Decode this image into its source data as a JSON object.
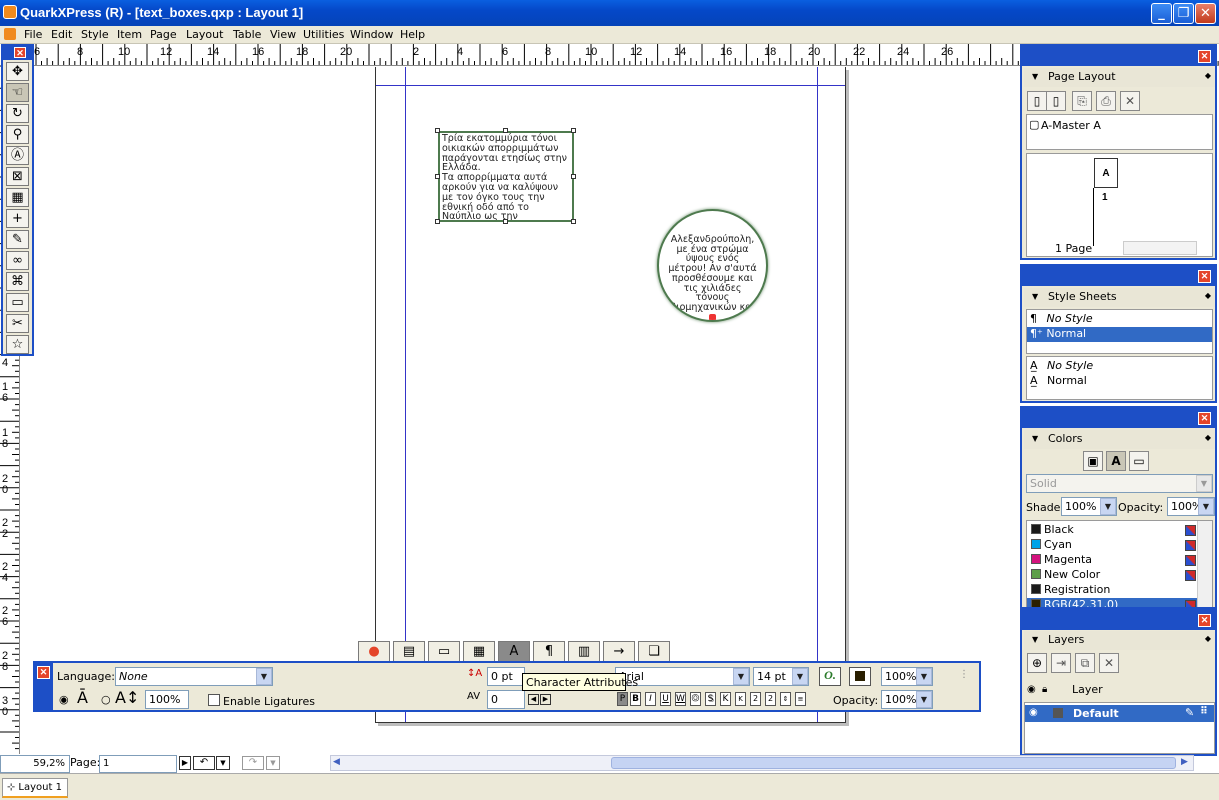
{
  "window": {
    "title": "QuarkXPress (R) - [text_boxes.qxp : Layout 1]",
    "min": "_",
    "restore": "❐",
    "close": "✕"
  },
  "menubar": {
    "items": [
      "File",
      "Edit",
      "Style",
      "Item",
      "Page",
      "Layout",
      "Table",
      "View",
      "Utilities",
      "Window",
      "Help"
    ],
    "mdi": [
      "_",
      "❐",
      "✕"
    ]
  },
  "rulers": {
    "horizontal": [
      "6",
      "8",
      "10",
      "12",
      "14",
      "16",
      "18",
      "20",
      "2",
      "4",
      "6",
      "8",
      "10",
      "12",
      "14",
      "16",
      "18",
      "20",
      "22",
      "24",
      "26"
    ],
    "vertical": [
      "4",
      "1 6",
      "1 8",
      "2 0",
      "2 2",
      "2 4",
      "2 6",
      "2 8",
      "3 0"
    ]
  },
  "document": {
    "textbox1": {
      "text": "Τρία εκατομμύρια τόνοι οικιακών απορριμμάτων παράγονται ετησίως στην Ελλάδα.\nΤα απορρίμματα αυτά αρκούν για να καλύψουν με τον όγκο τους την εθνική οδό από το Ναύπλιο ως την"
    },
    "textbox2": {
      "text": "Αλεξανδρούπολη, με ένα στρώμα ύψους ενός μέτρου! Αν σ'αυτά προσθέσουμε και τις χιλιάδες τόνους βιομηχανικών και"
    }
  },
  "page_layout": {
    "title": "Page Layout",
    "master": "A-Master A",
    "page_letter": "A",
    "page_number": "1",
    "page_count": "1 Page"
  },
  "style_sheets": {
    "title": "Style Sheets",
    "paragraph": [
      {
        "label": "No Style",
        "glyph": "¶"
      },
      {
        "label": "Normal",
        "glyph": "¶⁺",
        "selected": true
      }
    ],
    "character": [
      {
        "label": "No Style",
        "glyph": "A̲"
      },
      {
        "label": "Normal",
        "glyph": "A̲"
      }
    ]
  },
  "colors": {
    "title": "Colors",
    "fill_type": "Solid",
    "shade_label": "Shade:",
    "shade_value": "100%",
    "opacity_label": "Opacity:",
    "opacity_value": "100%",
    "items": [
      {
        "name": "Black",
        "color": "#1a1a1a"
      },
      {
        "name": "Cyan",
        "color": "#00a3e8"
      },
      {
        "name": "Magenta",
        "color": "#d4127e"
      },
      {
        "name": "New Color",
        "color": "#5e9f4a"
      },
      {
        "name": "Registration",
        "color": "#1a1a1a"
      },
      {
        "name": "RGB(42,31,0)",
        "color": "#2a1f00",
        "selected": true
      }
    ]
  },
  "layers": {
    "title": "Layers",
    "header": "Layer",
    "items": [
      {
        "name": "Default",
        "selected": true
      }
    ]
  },
  "measurements": {
    "language_label": "Language:",
    "language_value": "None",
    "scale_value": "100%",
    "ligatures_label": "Enable Ligatures",
    "leading_value": "0 pt",
    "tracking_value": "0",
    "font_value": "Arial",
    "size_value": "14 pt",
    "shade_value": "100%",
    "opacity_label": "Opacity:",
    "opacity_value": "100%",
    "tooltip": "Character Attributes",
    "style_buttons": [
      "P",
      "B",
      "I",
      "U",
      "W",
      "O",
      "S",
      "K",
      "K",
      "2",
      "2"
    ]
  },
  "statusbar": {
    "zoom": "59,2%",
    "page_label": "Page:",
    "page_value": "1",
    "layout_tab": "Layout 1"
  }
}
